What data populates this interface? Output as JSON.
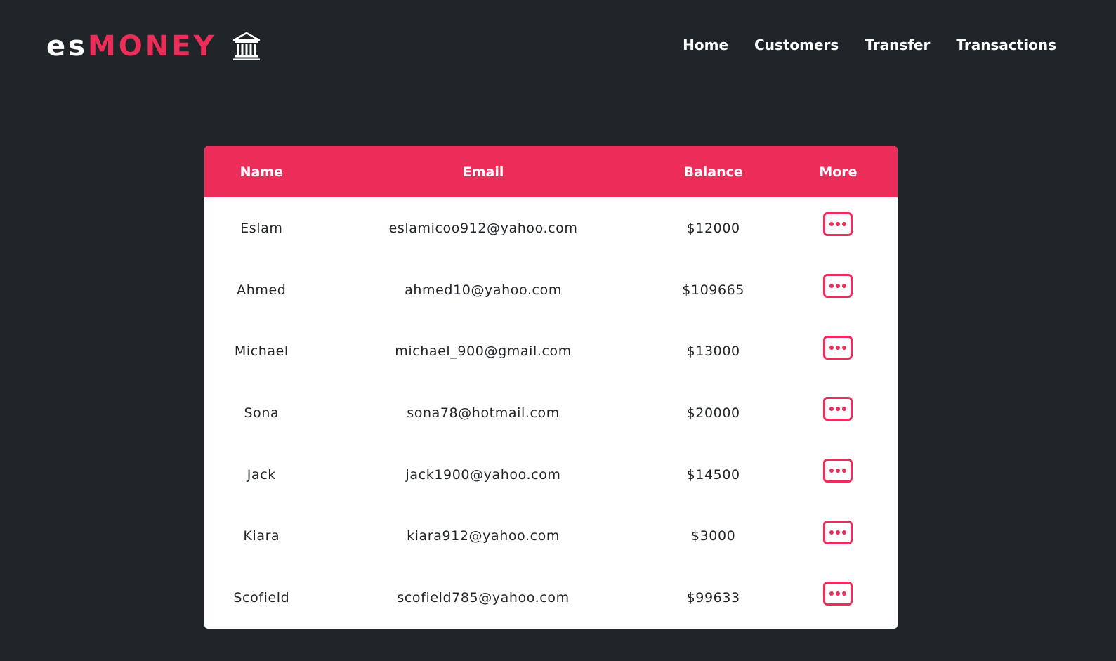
{
  "brand": {
    "prefix": "es",
    "name": "MONEY",
    "icon": "bank-icon",
    "accent_color": "#ec2c59"
  },
  "nav": {
    "items": [
      {
        "label": "Home"
      },
      {
        "label": "Customers"
      },
      {
        "label": "Transfer"
      },
      {
        "label": "Transactions"
      }
    ]
  },
  "table": {
    "headers": {
      "name": "Name",
      "email": "Email",
      "balance": "Balance",
      "more": "More"
    },
    "rows": [
      {
        "name": "Eslam",
        "email": "eslamicoo912@yahoo.com",
        "balance": "$12000"
      },
      {
        "name": "Ahmed",
        "email": "ahmed10@yahoo.com",
        "balance": "$109665"
      },
      {
        "name": "Michael",
        "email": "michael_900@gmail.com",
        "balance": "$13000"
      },
      {
        "name": "Sona",
        "email": "sona78@hotmail.com",
        "balance": "$20000"
      },
      {
        "name": "Jack",
        "email": "jack1900@yahoo.com",
        "balance": "$14500"
      },
      {
        "name": "Kiara",
        "email": "kiara912@yahoo.com",
        "balance": "$3000"
      },
      {
        "name": "Scofield",
        "email": "scofield785@yahoo.com",
        "balance": "$99633"
      }
    ],
    "more_icon": "more-dots-icon"
  },
  "colors": {
    "background": "#1f2529",
    "header_row": "#ec2c59",
    "table_bg": "#ffffff"
  }
}
